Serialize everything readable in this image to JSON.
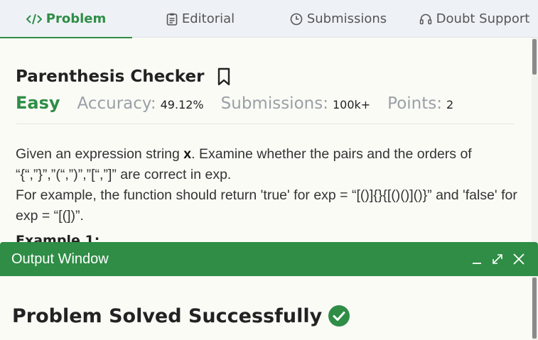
{
  "tabs": [
    {
      "label": "Problem",
      "icon": "code-icon",
      "active": true
    },
    {
      "label": "Editorial",
      "icon": "editorial-icon",
      "active": false
    },
    {
      "label": "Submissions",
      "icon": "clock-icon",
      "active": false
    },
    {
      "label": "Doubt Support",
      "icon": "headset-icon",
      "active": false
    }
  ],
  "problem": {
    "title": "Parenthesis Checker",
    "difficulty": "Easy",
    "accuracy_label": "Accuracy:",
    "accuracy_value": "49.12%",
    "submissions_label": "Submissions:",
    "submissions_value": "100k+",
    "points_label": "Points:",
    "points_value": "2",
    "description": {
      "intro": "Given an expression string ",
      "var": "x",
      "line1_rest": ". Examine whether the pairs and the orders of “{“,”}”,”(“,”)”,”[“,”]” are correct in exp.",
      "line2": "For example, the function should return 'true' for exp = “[()]{}{[()()]()}” and 'false' for exp = “[(])”."
    },
    "example_heading": "Example 1:"
  },
  "output_window": {
    "title": "Output Window",
    "minimize": "–",
    "expand": "⤢",
    "close": "✕",
    "status": "Problem Solved Successfully"
  },
  "colors": {
    "accent": "#2f8d46",
    "muted": "#9aa0a6"
  }
}
